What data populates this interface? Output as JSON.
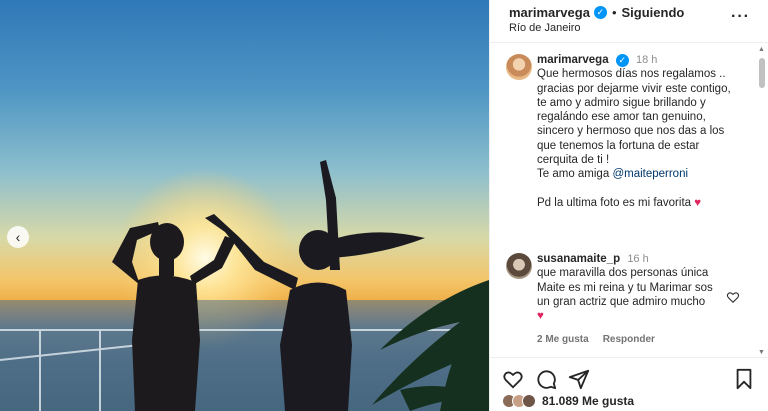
{
  "post": {
    "username": "marimarvega",
    "follow_separator": "•",
    "follow_label": "Siguiendo",
    "location": "Río de Janeiro"
  },
  "caption": {
    "username": "marimarvega",
    "time": "18 h",
    "lines": [
      "Que hermosos días nos regalamos ..",
      "gracias por dejarme vivir este contigo,",
      "te amo y admiro sigue brillando y",
      "regalándo ese amor tan genuino,",
      "sincero y hermoso que nos das a los",
      "que tenemos la fortuna de estar",
      "cerquita de ti !"
    ],
    "closing_prefix": "Te amo amiga ",
    "mention": "@maiteperroni",
    "footer": "Pd la ultima foto es mi favorita",
    "heart": "♥"
  },
  "comment": {
    "username": "susanamaite_p",
    "time": "16 h",
    "lines": [
      "que maravilla dos personas única",
      "Maite es mi reina y tu Marimar sos",
      "un gran actriz que admiro mucho"
    ],
    "heart": "♥",
    "likes": "2 Me gusta",
    "reply": "Responder"
  },
  "actions": {
    "likes_count": "81.089",
    "likes_label": "Me gusta"
  },
  "icons": [
    "chevron-left-icon",
    "verified-icon",
    "more-icon",
    "heart-icon",
    "comment-icon",
    "share-icon",
    "bookmark-icon"
  ],
  "colors": {
    "accent": "#0095f6",
    "heart": "#e0245e",
    "mention": "#00376b"
  }
}
